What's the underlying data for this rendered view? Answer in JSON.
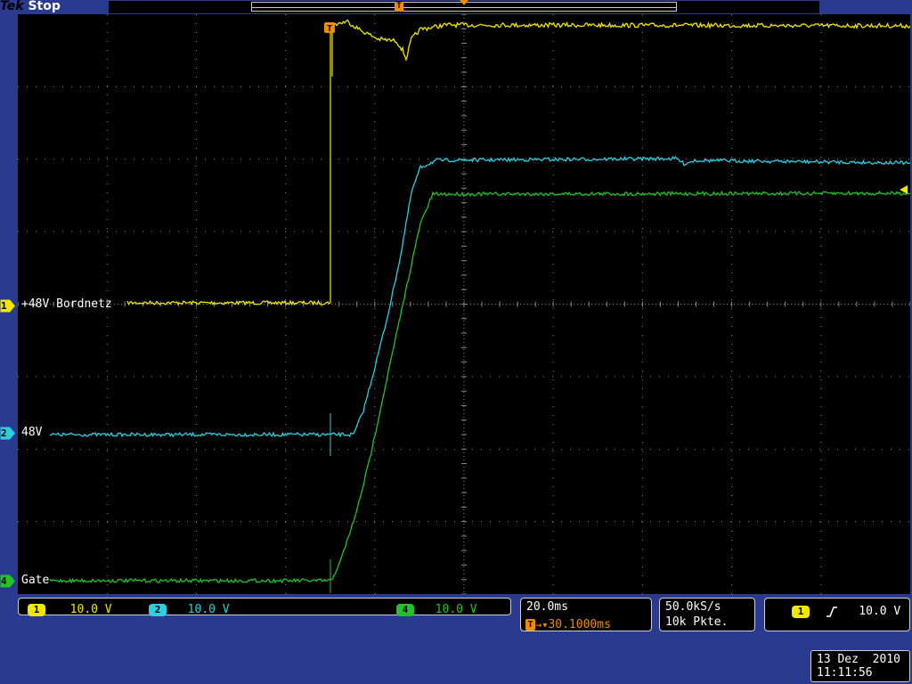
{
  "brand": {
    "name": "Tek",
    "state": "Stop"
  },
  "record": {
    "trigger_marker": "T"
  },
  "colors": {
    "ch1": "#f0e800",
    "ch2": "#2ad0e0",
    "ch4": "#22c32a",
    "accent": "#f08c00",
    "frame": "#2a3a8f",
    "grid": "#8a8a8a"
  },
  "traces": {
    "ch1": {
      "label": "+48V Bordnetz",
      "number": "1"
    },
    "ch2": {
      "label": "48V",
      "number": "2"
    },
    "ch4": {
      "label": "Gate",
      "number": "4"
    }
  },
  "trigger_flag": "T",
  "readouts": {
    "ch1": {
      "number": "1",
      "scale": "10.0 V"
    },
    "ch2": {
      "number": "2",
      "scale": "10.0 V"
    },
    "ch4": {
      "number": "4",
      "scale": "10.0 V"
    },
    "timebase": {
      "scale": "20.0ms",
      "trigger_pos_icon": "T",
      "trigger_pos": "30.1000ms"
    },
    "acquisition": {
      "rate": "50.0kS/s",
      "points": "10k Pkte."
    },
    "trigger": {
      "source": "1",
      "slope_icon": "rising-edge-icon",
      "level": "10.0 V"
    }
  },
  "datetime": {
    "date": "13 Dez  2010",
    "time": "11:11:56"
  }
}
